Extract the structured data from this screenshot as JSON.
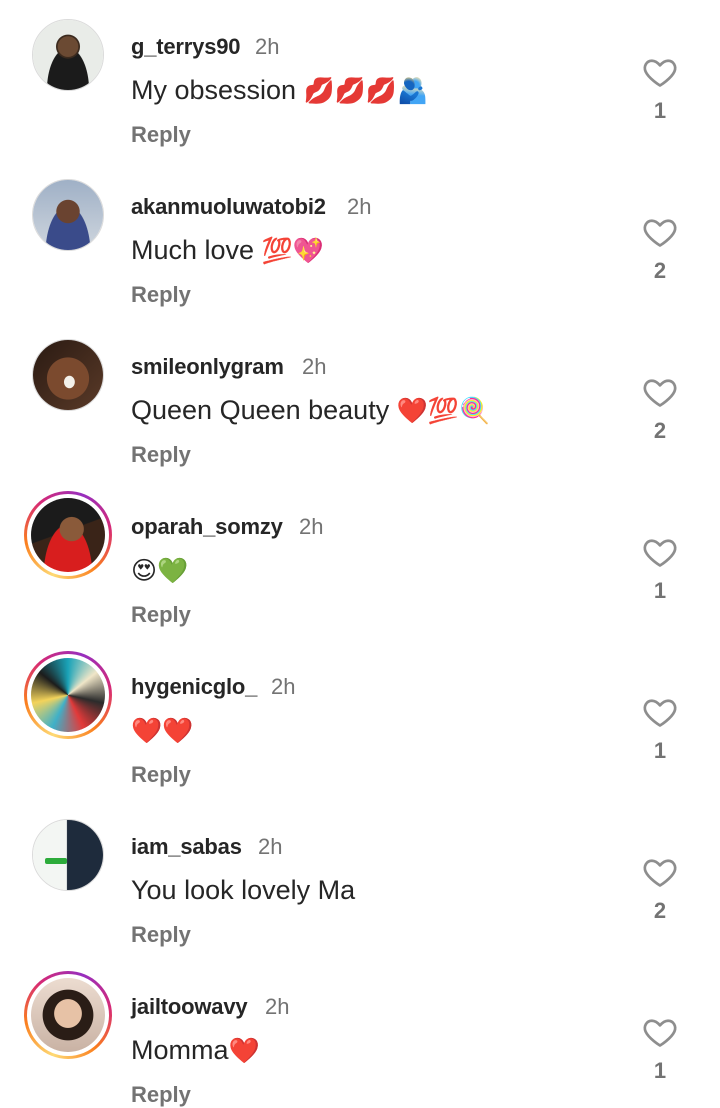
{
  "comments": [
    {
      "username": "g_terrys90",
      "time": "2h",
      "text": "My obsession ",
      "emoji": "💋💋💋🫂",
      "reply": "Reply",
      "likes": "1",
      "story_ring": false
    },
    {
      "username": "akanmuoluwatobi2",
      "time": "2h",
      "text": "Much love ",
      "emoji": "💯💖",
      "reply": "Reply",
      "likes": "2",
      "story_ring": false
    },
    {
      "username": "smileonlygram",
      "time": "2h",
      "text": "Queen Queen beauty ",
      "emoji": "❤️💯🍭",
      "reply": "Reply",
      "likes": "2",
      "story_ring": false
    },
    {
      "username": "oparah_somzy",
      "time": "2h",
      "text": "",
      "emoji": "😍💚",
      "reply": "Reply",
      "likes": "1",
      "story_ring": true
    },
    {
      "username": "hygenicglo_",
      "time": "2h",
      "text": "",
      "emoji": "❤️❤️",
      "reply": "Reply",
      "likes": "1",
      "story_ring": true
    },
    {
      "username": "iam_sabas",
      "time": "2h",
      "text": "You look lovely Ma",
      "emoji": "",
      "reply": "Reply",
      "likes": "2",
      "story_ring": false
    },
    {
      "username": "jailtoowavy",
      "time": "2h",
      "text": "Momma",
      "emoji": "❤️",
      "reply": "Reply",
      "likes": "1",
      "story_ring": true
    }
  ],
  "icons": {
    "like": "heart-outline-icon",
    "avatar": "profile-avatar"
  },
  "colors": {
    "primary_text": "#262626",
    "secondary_text": "#737373",
    "story_ring_start": "#feda75",
    "story_ring_end": "#d62976"
  }
}
